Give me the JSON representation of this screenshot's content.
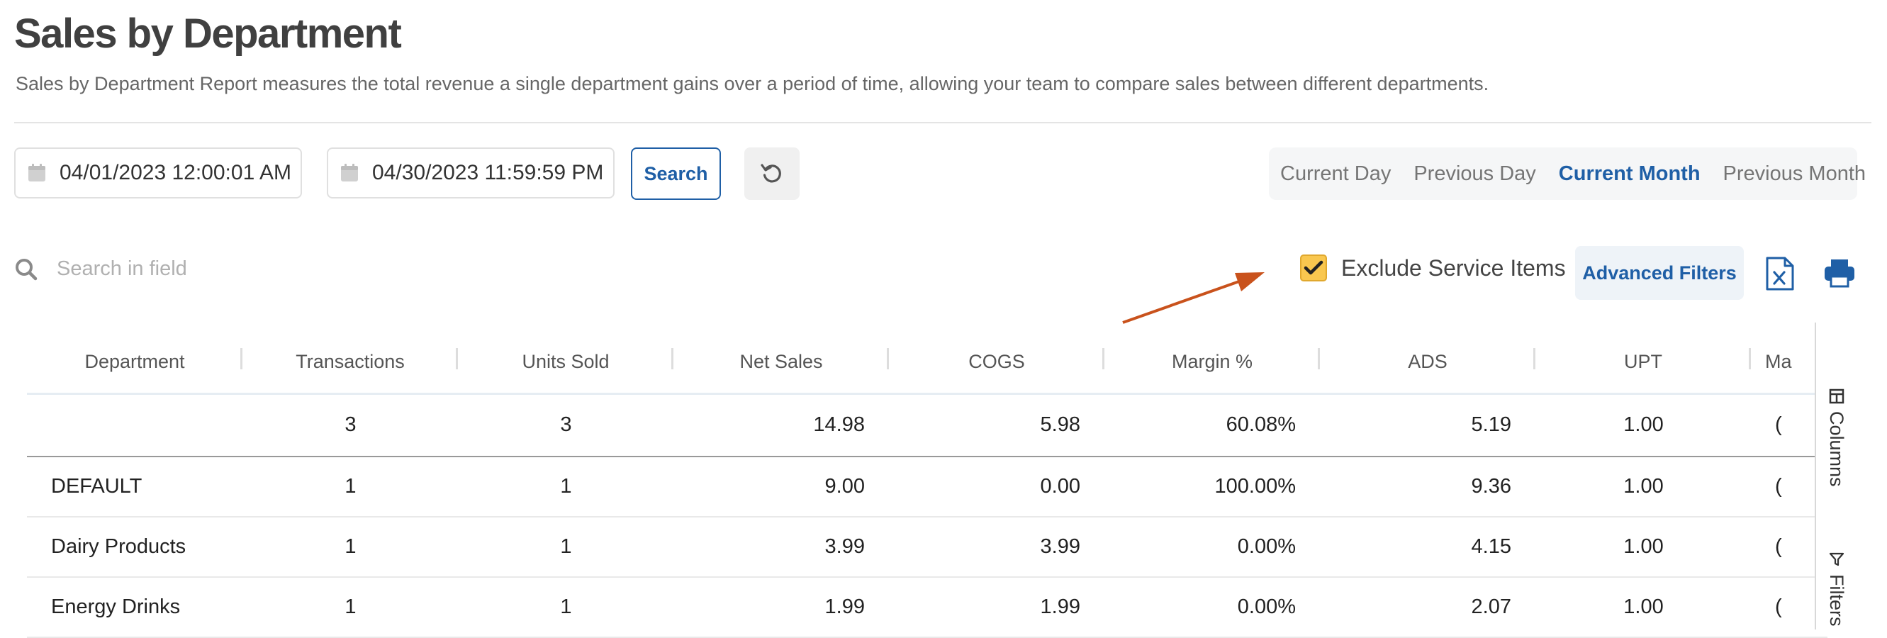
{
  "page": {
    "title": "Sales by Department",
    "subtitle": "Sales by Department Report measures the total revenue a single department gains over a period of time, allowing your team to compare sales between different departments."
  },
  "filters": {
    "start_date": "04/01/2023 12:00:01 AM",
    "end_date": "04/30/2023 11:59:59 PM",
    "search_label": "Search",
    "periods": [
      "Current Day",
      "Previous Day",
      "Current Month",
      "Previous Month"
    ],
    "active_period": "Current Month"
  },
  "toolbar": {
    "search_placeholder": "Search in field",
    "exclude_service_items_label": "Exclude Service Items",
    "exclude_service_items_checked": true,
    "advanced_filters_label": "Advanced Filters"
  },
  "table": {
    "columns": [
      "Department",
      "Transactions",
      "Units Sold",
      "Net Sales",
      "COGS",
      "Margin %",
      "ADS",
      "UPT",
      "Ma"
    ],
    "total_row": [
      "",
      "3",
      "3",
      "14.98",
      "5.98",
      "60.08%",
      "5.19",
      "1.00",
      "("
    ],
    "rows": [
      [
        "DEFAULT",
        "1",
        "1",
        "9.00",
        "0.00",
        "100.00%",
        "9.36",
        "1.00",
        "("
      ],
      [
        "Dairy Products",
        "1",
        "1",
        "3.99",
        "3.99",
        "0.00%",
        "4.15",
        "1.00",
        "("
      ],
      [
        "Energy Drinks",
        "1",
        "1",
        "1.99",
        "1.99",
        "0.00%",
        "2.07",
        "1.00",
        "("
      ]
    ]
  },
  "side_panel": {
    "columns_label": "Columns",
    "filters_label": "Filters"
  },
  "colors": {
    "accent": "#1f5fa6",
    "checkbox": "#f9c74f",
    "arrow": "#c9521c"
  }
}
